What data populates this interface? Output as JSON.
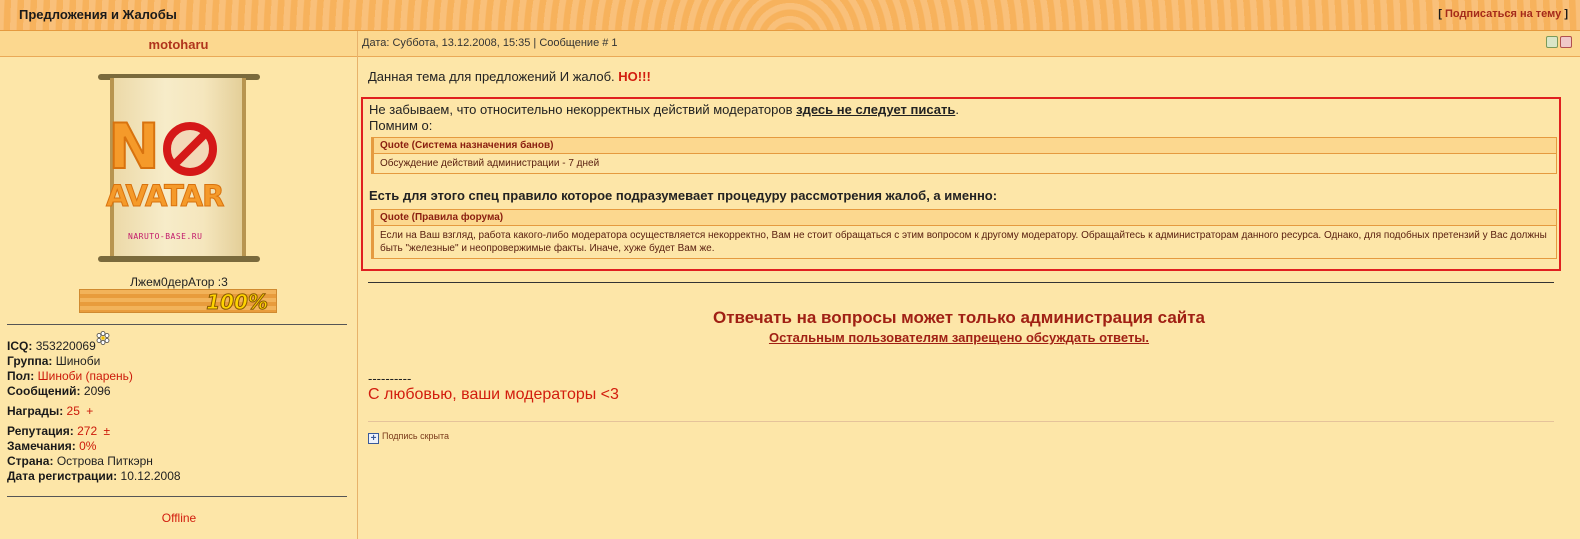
{
  "header": {
    "title": "Предложения и Жалобы",
    "subscribe_label": "Подписаться на тему",
    "bracket_open": "[",
    "bracket_close": "]"
  },
  "user": {
    "name": "motoharu",
    "avatar_text_no": "N",
    "avatar_text": "AVATAR",
    "avatar_site": "NARUTO-BASE.RU",
    "rank": "Лжем0дерАтор :3",
    "rank_progress": "100%",
    "icq_label": "ICQ:",
    "icq_value": "353220069",
    "group_label": "Группа:",
    "group_value": "Шиноби",
    "sex_label": "Пол:",
    "sex_value": "Шиноби (парень)",
    "posts_label": "Сообщений:",
    "posts_value": "2096",
    "awards_label": "Награды:",
    "awards_value": "25",
    "awards_plus": "+",
    "rep_label": "Репутация:",
    "rep_value": "272",
    "rep_pm": "±",
    "warn_label": "Замечания:",
    "warn_value": "0%",
    "country_label": "Страна:",
    "country_value": "Острова Питкэрн",
    "reg_label": "Дата регистрации:",
    "reg_value": "10.12.2008",
    "status": "Offline"
  },
  "post": {
    "meta": "Дата: Суббота, 13.12.2008, 15:35 | Сообщение # 1",
    "intro": "Данная тема для предложений И жалоб.",
    "intro_hot": "НО!!!",
    "box_line1_pre": "Не забываем, что относительно некорректных действий модераторов",
    "box_line1_link": "здесь не следует писать",
    "box_line1_post": ".",
    "box_line2": "Помним о:",
    "quote1_title": "Quote (Система назначения банов)",
    "quote1_body": "Обсуждение действий администрации - 7 дней",
    "box_line3": "Есть для этого спец правило которое подразумевает процедуру рассмотрения жалоб, а именно:",
    "quote2_title": "Quote (Правила форума)",
    "quote2_body": "Если на Ваш взгляд, работа какого-либо модератора осуществляется некорректно, Вам не стоит обращаться с этим вопросом к другому модератору. Обращайтесь к администраторам данного ресурса. Однако, для подобных претензий у Вас должны быть \"железные\" и неопровержимые факты. Иначе, хуже будет Вам же.",
    "announce1": "Отвечать на вопросы может только администрация сайта",
    "announce2": "Остальным пользователям запрещено обсуждать ответы.",
    "dashes": "----------",
    "signoff": "С любовью, ваши модераторы <3",
    "signature_toggle": "Подпись скрыта"
  }
}
